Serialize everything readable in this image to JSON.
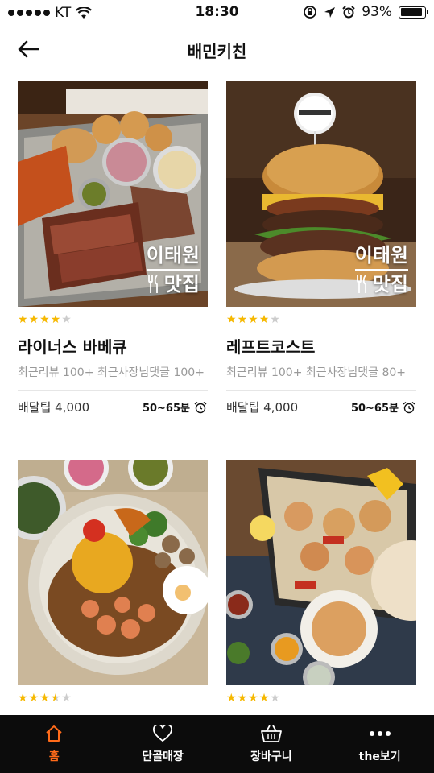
{
  "status": {
    "carrier": "KT",
    "time": "18:30",
    "battery": "93%",
    "battery_level": 0.93
  },
  "header": {
    "title": "배민키친"
  },
  "restaurants": [
    {
      "name": "라이너스 바베큐",
      "rating": 4,
      "reviews": "최근리뷰 100+  최근사장님댓글 100+",
      "tip": "배달팁 4,000",
      "time": "50~65분",
      "badge_top": "이태원",
      "badge_bottom": "맛집"
    },
    {
      "name": "레프트코스트",
      "rating": 4,
      "reviews": "최근리뷰 100+  최근사장님댓글 80+",
      "tip": "배달팁 4,000",
      "time": "50~65분",
      "badge_top": "이태원",
      "badge_bottom": "맛집"
    },
    {
      "name": "",
      "rating": 3.5
    },
    {
      "name": "",
      "rating": 4
    }
  ],
  "nav": [
    {
      "label": "홈",
      "icon": "home-icon",
      "active": true
    },
    {
      "label": "단골매장",
      "icon": "heart-icon",
      "active": false
    },
    {
      "label": "장바구니",
      "icon": "basket-icon",
      "active": false
    },
    {
      "label": "the보기",
      "icon": "more-icon",
      "active": false
    }
  ],
  "colors": {
    "accent": "#ff6b1a",
    "star": "#f6b800",
    "nav_bg": "#0c0c0c"
  }
}
